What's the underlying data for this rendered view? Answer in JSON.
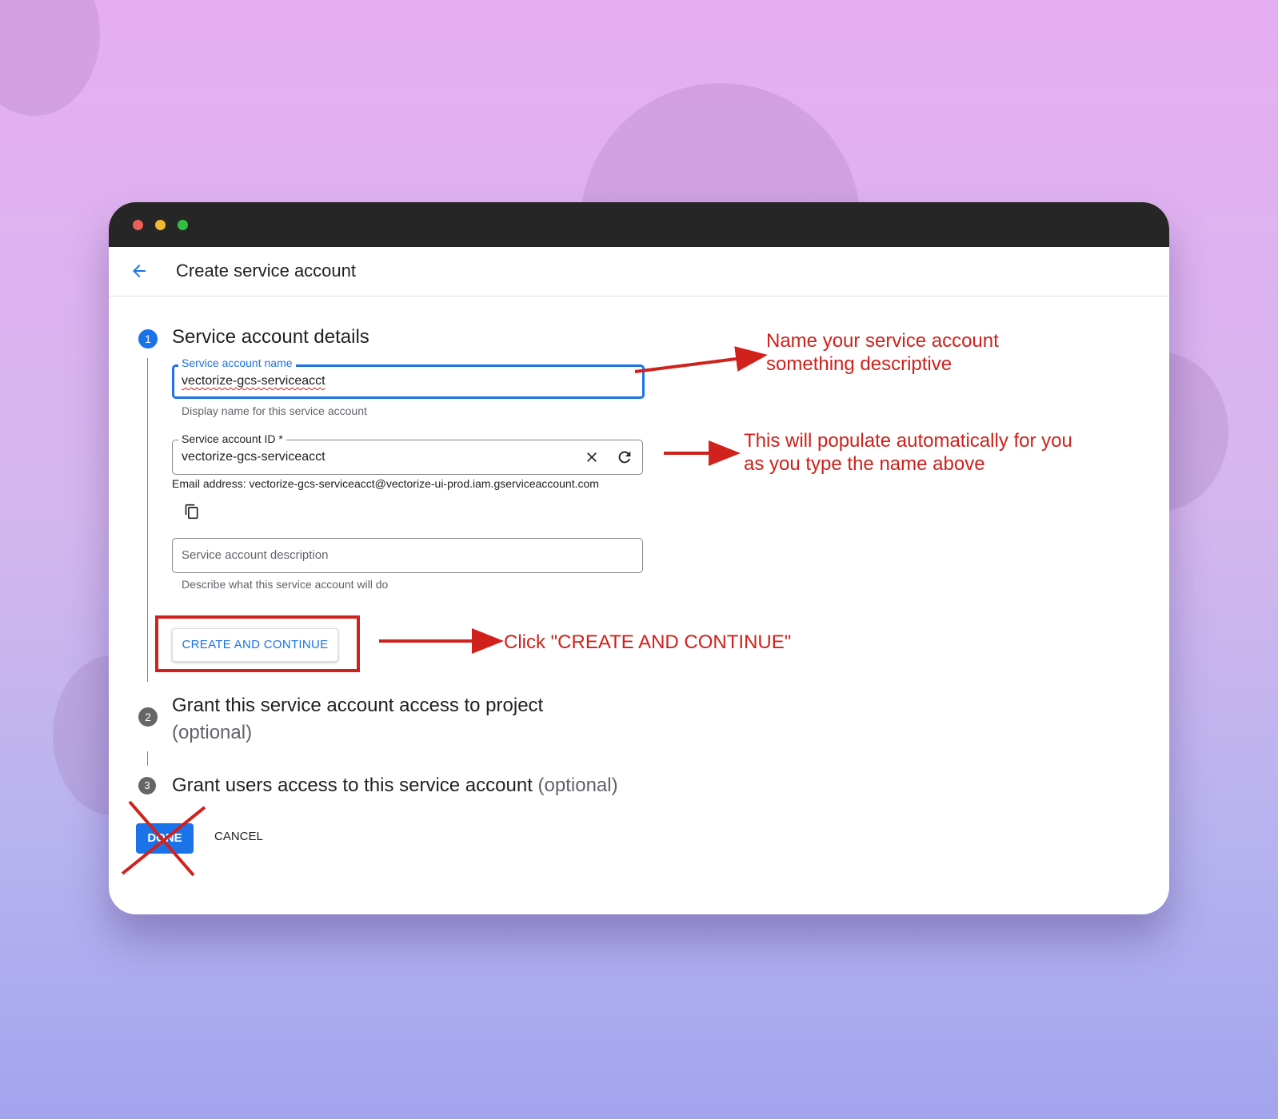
{
  "window": {
    "page_title": "Create service account"
  },
  "steps": [
    {
      "number": "1",
      "title": "Service account details",
      "optional": ""
    },
    {
      "number": "2",
      "title": "Grant this service account access to project",
      "optional": "(optional)"
    },
    {
      "number": "3",
      "title": "Grant users access to this service account",
      "optional": "(optional)"
    }
  ],
  "form": {
    "name_field": {
      "label": "Service account name",
      "value": "vectorize-gcs-serviceacct",
      "hint": "Display name for this service account"
    },
    "id_field": {
      "label": "Service account ID *",
      "value": "vectorize-gcs-serviceacct"
    },
    "email_line": "Email address: vectorize-gcs-serviceacct@vectorize-ui-prod.iam.gserviceaccount.com",
    "description_field": {
      "placeholder": "Service account description",
      "hint": "Describe what this service account will do"
    }
  },
  "buttons": {
    "create_continue": "CREATE AND CONTINUE",
    "done": "DONE",
    "cancel": "CANCEL"
  },
  "icons": [
    "back-arrow-icon",
    "clear-icon",
    "refresh-icon",
    "copy-icon"
  ],
  "annotations": {
    "name_note_line1": "Name your service account",
    "name_note_line2": "something descriptive",
    "id_note_line1": "This will populate automatically for you",
    "id_note_line2": "as you type the name above",
    "click_note": "Click \"CREATE AND CONTINUE\""
  },
  "colors": {
    "accent": "#1a73e8",
    "annotation_red": "#d0211c",
    "titlebar": "#262626"
  }
}
